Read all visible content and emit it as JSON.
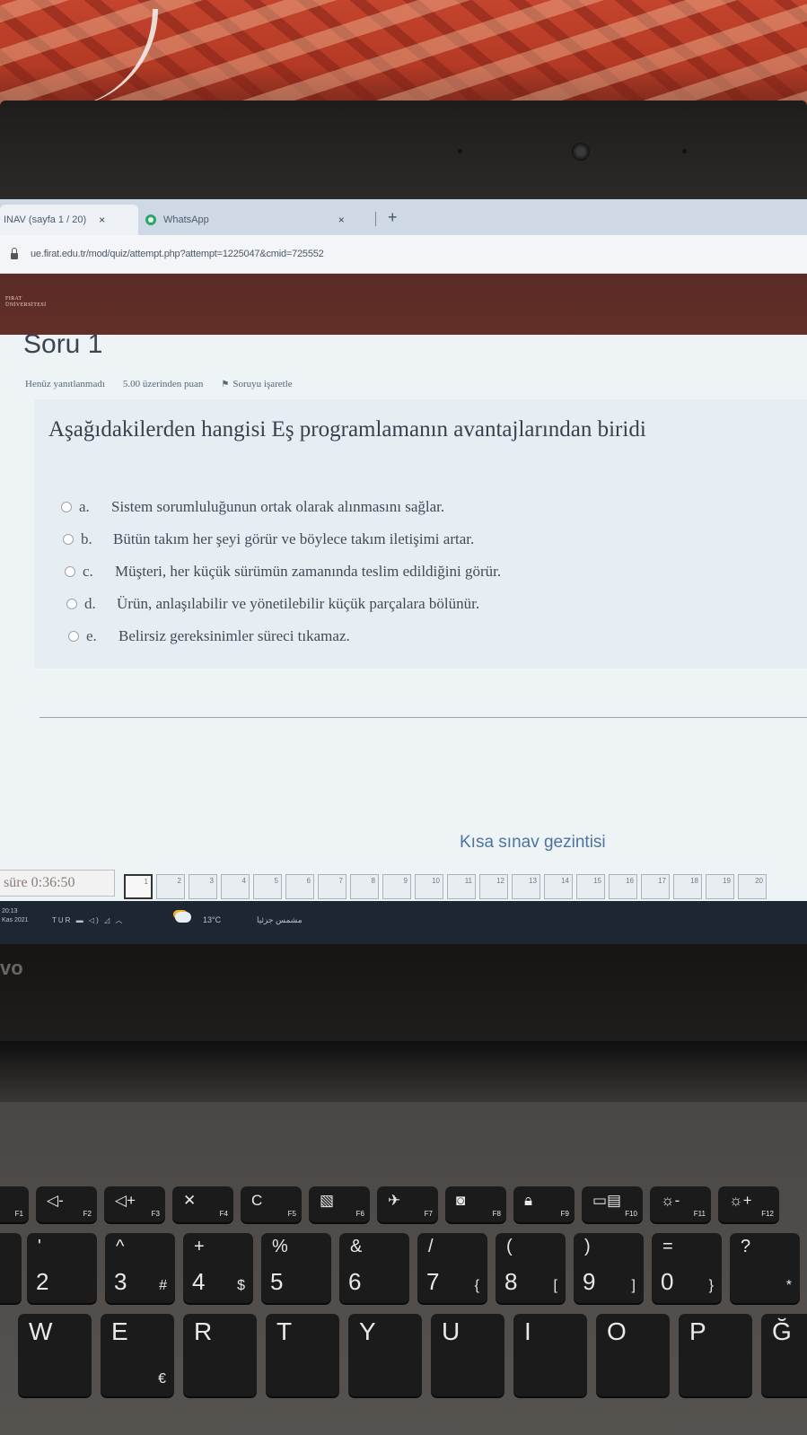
{
  "browser": {
    "tabs": [
      {
        "label": "INAV (sayfa 1 / 20)",
        "close": "×"
      },
      {
        "label": "WhatsApp",
        "close": "×"
      }
    ],
    "new_tab": "+",
    "url": "ue.firat.edu.tr/mod/quiz/attempt.php?attempt=1225047&cmid=725552"
  },
  "brand": {
    "line1": "FIRAT",
    "line2": "ÜNİVERSİTESİ"
  },
  "question": {
    "title": "Soru 1",
    "status": "Henüz yanıtlanmadı",
    "points": "5.00 üzerinden puan",
    "flag": "Soruyu işaretle",
    "text": "Aşağıdakilerden hangisi Eş programlamanın avantajlarından biridi",
    "options": [
      {
        "letter": "a.",
        "text": "Sistem sorumluluğunun ortak olarak alınmasını sağlar."
      },
      {
        "letter": "b.",
        "text": "Bütün takım her şeyi görür ve böylece takım iletişimi artar."
      },
      {
        "letter": "c.",
        "text": "Müşteri, her küçük sürümün zamanında teslim edildiğini görür."
      },
      {
        "letter": "d.",
        "text": "Ürün, anlaşılabilir ve yönetilebilir küçük parçalara bölünür."
      },
      {
        "letter": "e.",
        "text": "Belirsiz gereksinimler süreci tıkamaz."
      }
    ]
  },
  "quiz_nav": {
    "title": "Kısa sınav gezintisi",
    "timer": "süre 0:36:50",
    "buttons": [
      "1",
      "2",
      "3",
      "4",
      "5",
      "6",
      "7",
      "8",
      "9",
      "10",
      "11",
      "12",
      "13",
      "14",
      "15",
      "16",
      "17",
      "18",
      "19",
      "20"
    ]
  },
  "taskbar": {
    "time": "20:13",
    "date": "Kas 2021",
    "tray": "TUR",
    "weather_temp": "13°C",
    "weather_desc": "مشمس جزئيا"
  },
  "laptop": {
    "logo": "vo"
  },
  "keyboard": {
    "fn_row": [
      {
        "sym": "◁-",
        "label": "F2"
      },
      {
        "sym": "◁+",
        "label": "F3"
      },
      {
        "sym": "✕",
        "label": "F4"
      },
      {
        "sym": "C",
        "label": "F5"
      },
      {
        "sym": "▧",
        "label": "F6"
      },
      {
        "sym": "✈",
        "label": "F7"
      },
      {
        "sym": "◙",
        "label": "F8"
      },
      {
        "sym": "🔒︎",
        "label": "F9"
      },
      {
        "sym": "▭▤",
        "label": "F10"
      },
      {
        "sym": "☼-",
        "label": "F11"
      },
      {
        "sym": "☼+",
        "label": "F12"
      }
    ],
    "f1": "F1",
    "num_row": [
      {
        "top": "'",
        "main": "2",
        "sub": ""
      },
      {
        "top": "^",
        "main": "3",
        "sub": "#"
      },
      {
        "top": "+",
        "main": "4",
        "sub": "$"
      },
      {
        "top": "%",
        "main": "5",
        "sub": ""
      },
      {
        "top": "&",
        "main": "6",
        "sub": ""
      },
      {
        "top": "/",
        "main": "7",
        "sub": "{"
      },
      {
        "top": "(",
        "main": "8",
        "sub": "["
      },
      {
        "top": ")",
        "main": "9",
        "sub": "]"
      },
      {
        "top": "=",
        "main": "0",
        "sub": "}"
      },
      {
        "top": "?",
        "main": "",
        "sub": "*"
      }
    ],
    "letter_row": [
      {
        "main": "W",
        "sub": ""
      },
      {
        "main": "E",
        "sub": "€"
      },
      {
        "main": "R",
        "sub": ""
      },
      {
        "main": "T",
        "sub": ""
      },
      {
        "main": "Y",
        "sub": ""
      },
      {
        "main": "U",
        "sub": ""
      },
      {
        "main": "I",
        "sub": ""
      },
      {
        "main": "O",
        "sub": ""
      },
      {
        "main": "P",
        "sub": ""
      },
      {
        "main": "Ğ",
        "sub": ""
      }
    ]
  }
}
